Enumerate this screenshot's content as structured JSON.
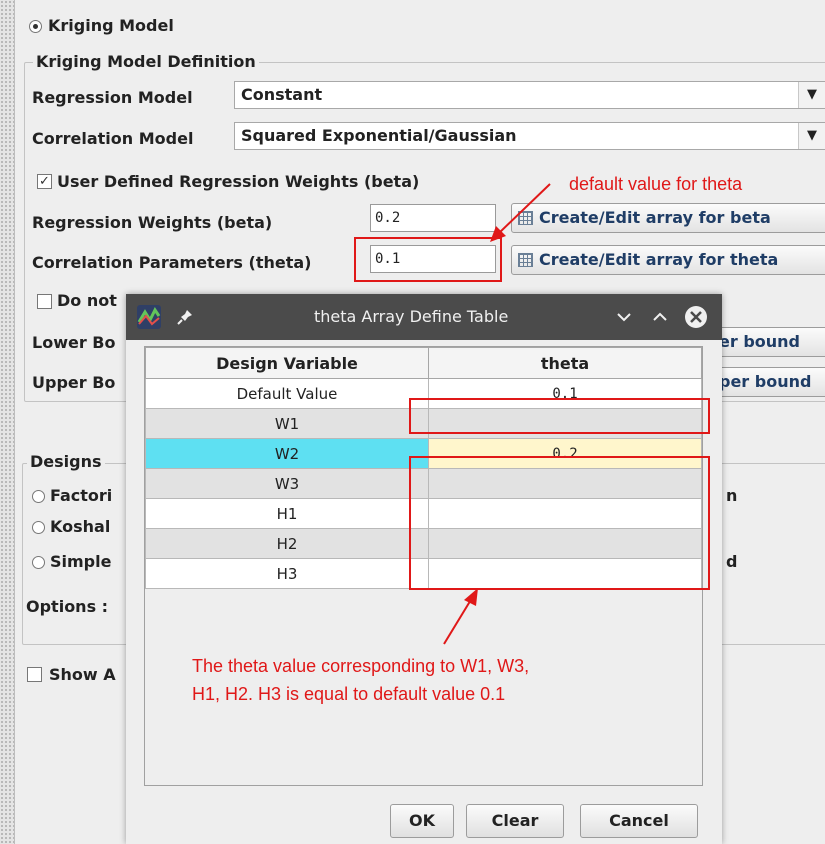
{
  "kriging_radio": "Kriging Model",
  "definition": {
    "legend": "Kriging Model Definition",
    "regression_label": "Regression Model",
    "regression_value": "Constant",
    "correlation_label": "Correlation Model",
    "correlation_value": "Squared Exponential/Gaussian",
    "user_weights_label": "User Defined Regression Weights (beta)",
    "beta_label": "Regression Weights (beta)",
    "beta_value": "0.2",
    "beta_button": "Create/Edit array for beta",
    "theta_label": "Correlation Parameters (theta)",
    "theta_value": "0.1",
    "theta_button": "Create/Edit array for theta",
    "do_not_label": "Do not",
    "lower_label": "Lower Bo",
    "lower_button": "er bound",
    "upper_label": "Upper Bo",
    "upper_button": "per bound"
  },
  "designs": {
    "legend": "Designs",
    "opt1": "Factori",
    "opt2": "Koshal",
    "opt3": "Simple",
    "opt1_suffix": "n",
    "opt3_suffix": "d",
    "options_label": "Options :",
    "show_label": "Show A"
  },
  "annotations": {
    "default_theta": "default value for theta",
    "note_line1": "The theta value corresponding to W1, W3,",
    "note_line2": "H1, H2. H3 is equal to default value 0.1"
  },
  "dialog": {
    "title": "theta Array Define Table",
    "columns": [
      "Design Variable",
      "theta"
    ],
    "rows": [
      {
        "name": "Default Value",
        "theta": "0.1"
      },
      {
        "name": "W1",
        "theta": ""
      },
      {
        "name": "W2",
        "theta": "0.2"
      },
      {
        "name": "W3",
        "theta": ""
      },
      {
        "name": "H1",
        "theta": ""
      },
      {
        "name": "H2",
        "theta": ""
      },
      {
        "name": "H3",
        "theta": ""
      }
    ],
    "ok": "OK",
    "clear": "Clear",
    "cancel": "Cancel"
  },
  "colors": {
    "annotation_red": "#e01818",
    "selected_cell": "#5ee0f2",
    "edit_cell": "#fff6cc",
    "gray_row": "#e2e2e2"
  }
}
